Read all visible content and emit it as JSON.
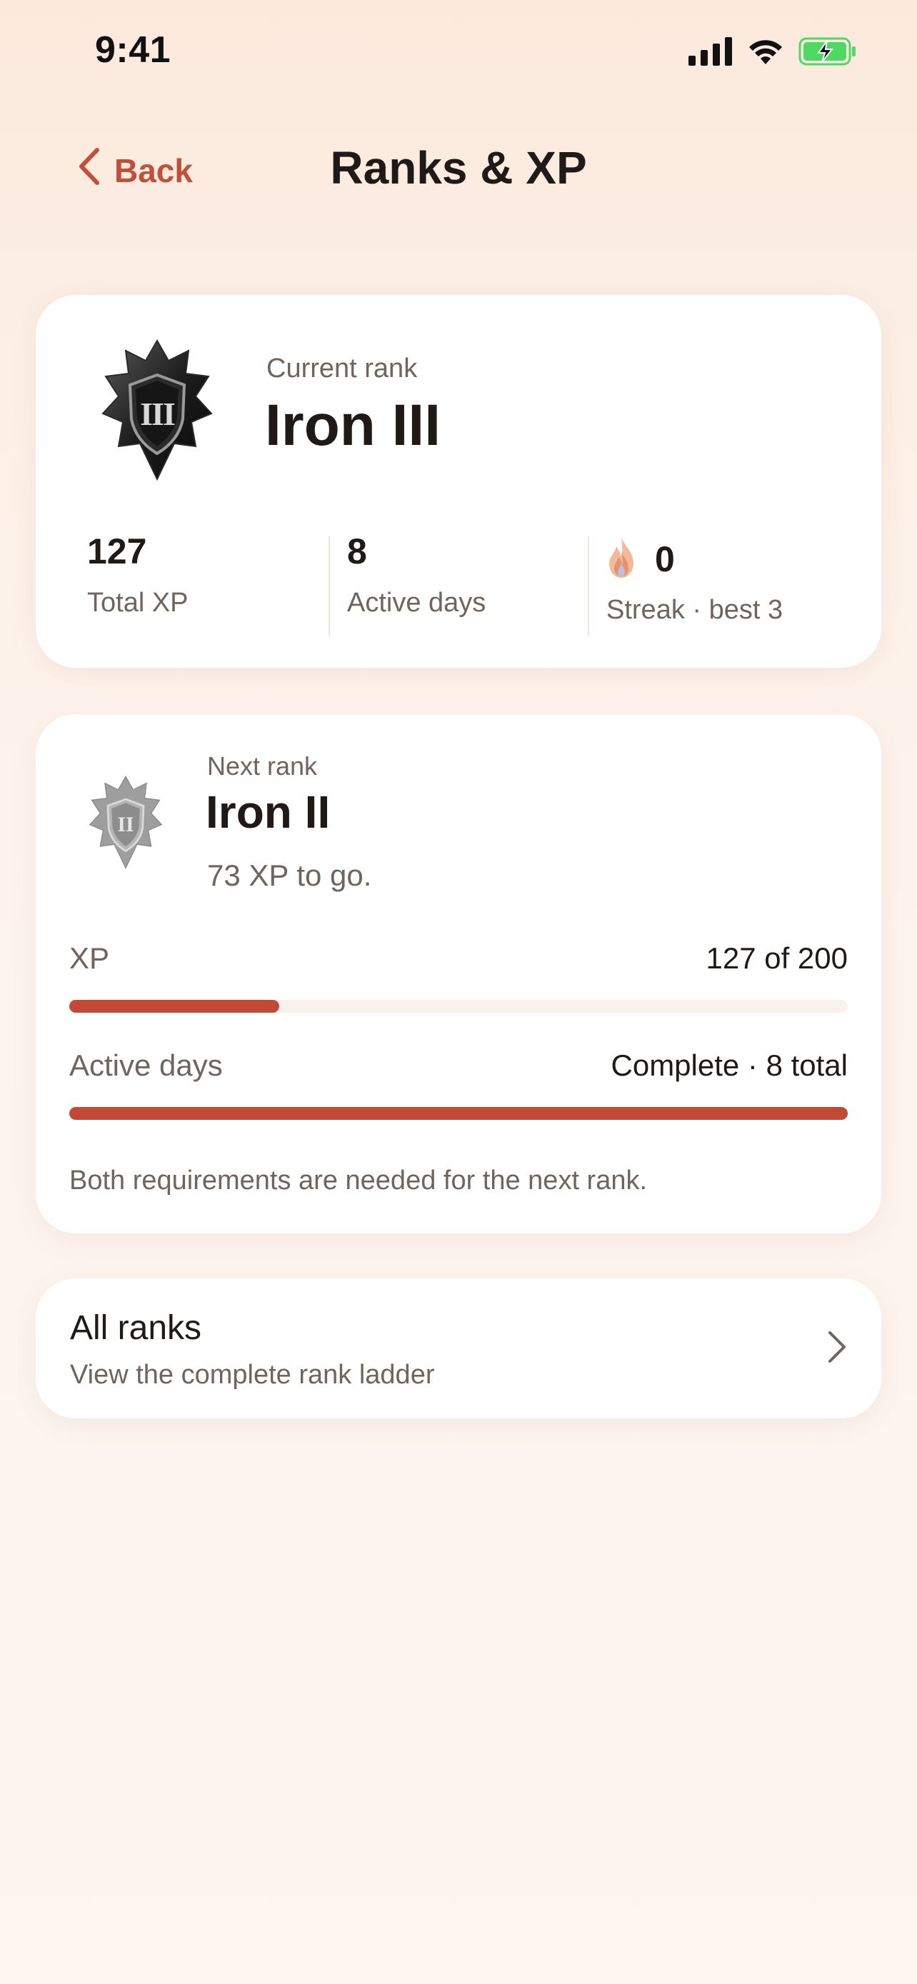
{
  "status_bar": {
    "time": "9:41"
  },
  "nav": {
    "back_label": "Back",
    "title": "Ranks & XP"
  },
  "current_rank": {
    "label": "Current rank",
    "name": "Iron III",
    "emblem_numeral": "III",
    "stats": [
      {
        "value": "127",
        "label": "Total XP"
      },
      {
        "value": "8",
        "label": "Active days"
      },
      {
        "value": "0",
        "label": "Streak · best 3",
        "icon": "flame-icon"
      }
    ]
  },
  "next_rank": {
    "label": "Next rank",
    "name": "Iron II",
    "emblem_numeral": "II",
    "subtitle": "73 XP to go.",
    "requirements": [
      {
        "label": "XP",
        "value": "127 of 200",
        "progress": 0.27
      },
      {
        "label": "Active days",
        "value": "Complete · 8 total",
        "progress": 1.0
      }
    ],
    "footnote": "Both requirements are needed for the next rank."
  },
  "all_ranks": {
    "title": "All ranks",
    "subtitle": "View the complete rank ladder"
  },
  "colors": {
    "accent": "#c24a35",
    "back": "#c0503a",
    "battery": "#4cd964"
  }
}
